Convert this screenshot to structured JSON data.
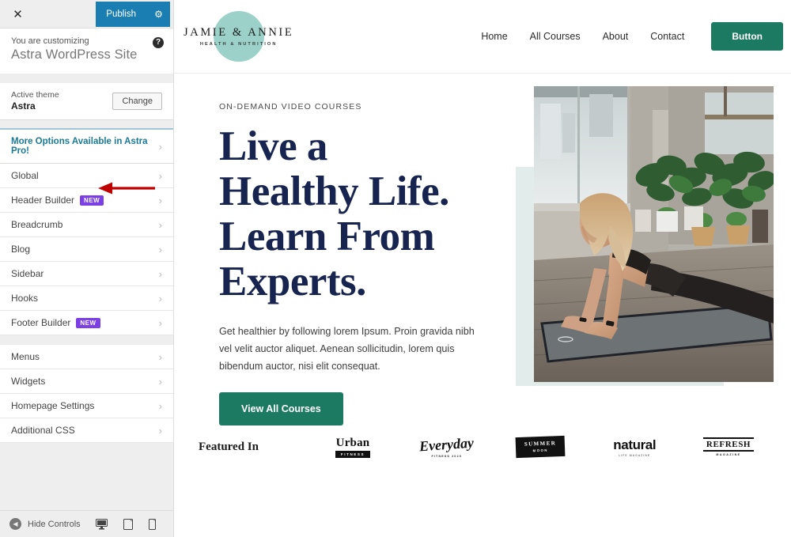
{
  "customizer": {
    "close_icon": "close-icon",
    "publish_label": "Publish",
    "gear_icon": "gear-icon",
    "customizing_label": "You are customizing",
    "site_name": "Astra WordPress Site",
    "help_icon": "help-icon",
    "active_theme_label": "Active theme",
    "active_theme_name": "Astra",
    "change_label": "Change",
    "pro_label": "More Options Available in Astra Pro!",
    "chevron": "›",
    "items": [
      {
        "label": "Global",
        "badge": ""
      },
      {
        "label": "Header Builder",
        "badge": "NEW"
      },
      {
        "label": "Breadcrumb",
        "badge": ""
      },
      {
        "label": "Blog",
        "badge": ""
      },
      {
        "label": "Sidebar",
        "badge": ""
      },
      {
        "label": "Hooks",
        "badge": ""
      },
      {
        "label": "Footer Builder",
        "badge": "NEW"
      }
    ],
    "items2": [
      {
        "label": "Menus",
        "badge": ""
      },
      {
        "label": "Widgets",
        "badge": ""
      },
      {
        "label": "Homepage Settings",
        "badge": ""
      },
      {
        "label": "Additional CSS",
        "badge": ""
      }
    ],
    "footer": {
      "collapse_icon": "collapse-icon",
      "hide_controls": "Hide Controls",
      "devices": [
        "desktop-preview-icon",
        "tablet-preview-icon",
        "mobile-preview-icon"
      ]
    },
    "annotation": {
      "name": "red-arrow-pointing-to-header-builder",
      "color": "#c00000"
    },
    "colors": {
      "publish": "#1b7eb2",
      "badge": "#7b3fe4",
      "pro_text": "#1a7a96"
    }
  },
  "site": {
    "logo": {
      "main": "JAMIE  &  ANNIE",
      "sub": "HEALTH & NUTRITION",
      "circle_color": "#92cdc4"
    },
    "nav": [
      {
        "label": "Home"
      },
      {
        "label": "All Courses"
      },
      {
        "label": "About"
      },
      {
        "label": "Contact"
      }
    ],
    "header_button": "Button",
    "hero": {
      "eyebrow": "ON-DEMAND VIDEO COURSES",
      "heading_lines": [
        "Live a",
        "Healthy Life.",
        "Learn From",
        "Experts."
      ],
      "paragraph": "Get healthier by following lorem Ipsum. Proin gravida nibh vel velit auctor aliquet. Aenean sollicitudin, lorem quis bibendum auctor, nisi elit consequat.",
      "cta": "View All Courses",
      "image_alt": "woman-doing-yoga-plank-pose-in-studio-with-plants",
      "frame_color": "#e2ecea",
      "accent_color": "#1d7a62",
      "heading_color": "#17244f"
    },
    "featured": {
      "label": "Featured In",
      "brands": [
        {
          "name": "Urban",
          "sub": "FITNESS"
        },
        {
          "name": "Everyday",
          "sub": "FITNESS 2020"
        },
        {
          "name": "SUMMER",
          "sub": "MOON"
        },
        {
          "name": "natural",
          "sub": "LIFE MAGAZINE"
        },
        {
          "name": "REFRESH",
          "sub": "MAGAZINE"
        }
      ]
    }
  }
}
